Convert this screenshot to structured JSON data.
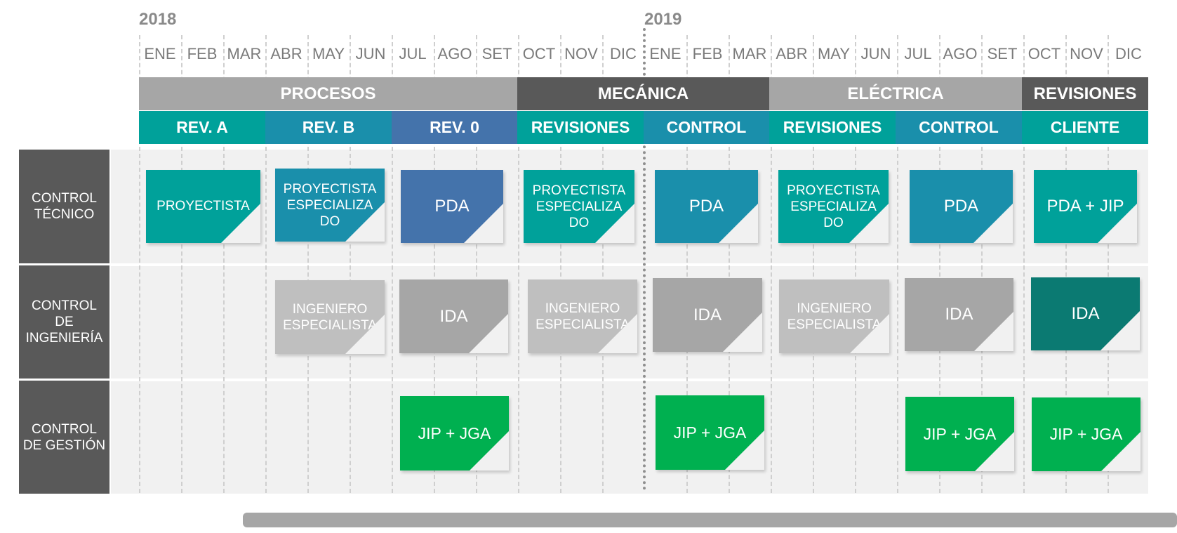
{
  "years": {
    "y1": "2018",
    "y2": "2019"
  },
  "months": [
    "ENE",
    "FEB",
    "MAR",
    "ABR",
    "MAY",
    "JUN",
    "JUL",
    "AGO",
    "SET",
    "OCT",
    "NOV",
    "DIC",
    "ENE",
    "FEB",
    "MAR",
    "ABR",
    "MAY",
    "JUN",
    "JUL",
    "AGO",
    "SET",
    "OCT",
    "NOV",
    "DIC"
  ],
  "phases": [
    {
      "label": "PROCESOS",
      "color": "#a6a6a6"
    },
    {
      "label": "MECÁNICA",
      "color": "#595959"
    },
    {
      "label": "ELÉCTRICA",
      "color": "#a6a6a6"
    },
    {
      "label": "REVISIONES",
      "color": "#595959"
    }
  ],
  "subphases": [
    {
      "label": "REV. A",
      "color": "#00a19a"
    },
    {
      "label": "REV. B",
      "color": "#1a8fab"
    },
    {
      "label": "REV. 0",
      "color": "#4473ab"
    },
    {
      "label": "REVISIONES",
      "color": "#00a19a"
    },
    {
      "label": "CONTROL",
      "color": "#1a8fab"
    },
    {
      "label": "REVISIONES",
      "color": "#00a19a"
    },
    {
      "label": "CONTROL",
      "color": "#1a8fab"
    },
    {
      "label": "CLIENTE",
      "color": "#00a19a"
    }
  ],
  "rows": [
    {
      "label": "CONTROL TÉCNICO"
    },
    {
      "label": "CONTROL DE INGENIERÍA"
    },
    {
      "label": "CONTROL DE GESTIÓN"
    }
  ],
  "notes": {
    "tecnico": [
      {
        "text": "PROYECTISTA",
        "color": "#00a19a"
      },
      {
        "text": "PROYECTISTA ESPECIALIZA DO",
        "color": "#1a8fab"
      },
      {
        "text": "PDA",
        "color": "#4473ab"
      },
      {
        "text": "PROYECTISTA ESPECIALIZA DO",
        "color": "#00a19a"
      },
      {
        "text": "PDA",
        "color": "#1a8fab"
      },
      {
        "text": "PROYECTISTA ESPECIALIZA DO",
        "color": "#00a19a"
      },
      {
        "text": "PDA",
        "color": "#1a8fab"
      },
      {
        "text": "PDA + JIP",
        "color": "#00a19a"
      }
    ],
    "ingenieria": [
      {
        "text": "INGENIERO ESPECIALISTA",
        "color": "#bfbfbf"
      },
      {
        "text": "IDA",
        "color": "#a6a6a6"
      },
      {
        "text": "INGENIERO ESPECIALISTA",
        "color": "#bfbfbf"
      },
      {
        "text": "IDA",
        "color": "#a6a6a6"
      },
      {
        "text": "INGENIERO ESPECIALISTA",
        "color": "#bfbfbf"
      },
      {
        "text": "IDA",
        "color": "#a6a6a6"
      },
      {
        "text": "IDA",
        "color": "#0b7a72"
      }
    ],
    "gestion": [
      {
        "text": "JIP + JGA",
        "color": "#00b050"
      },
      {
        "text": "JIP + JGA",
        "color": "#00b050"
      },
      {
        "text": "JIP + JGA",
        "color": "#00b050"
      },
      {
        "text": "JIP + JGA",
        "color": "#00b050"
      }
    ]
  }
}
